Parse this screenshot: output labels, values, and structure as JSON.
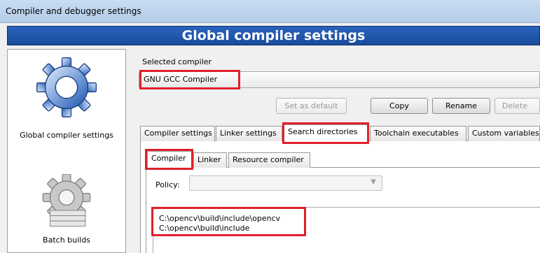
{
  "window": {
    "title": "Compiler and debugger settings"
  },
  "header": {
    "title": "Global compiler settings"
  },
  "sidebar": {
    "items": [
      {
        "label": "Global compiler settings",
        "icon": "gear-icon"
      },
      {
        "label": "Batch builds",
        "icon": "gear-stack-icon"
      }
    ]
  },
  "compiler": {
    "section_label": "Selected compiler",
    "selected": "GNU GCC Compiler",
    "buttons": {
      "set_default": "Set as default",
      "copy": "Copy",
      "rename": "Rename",
      "delete": "Delete"
    }
  },
  "tabs": [
    "Compiler settings",
    "Linker settings",
    "Search directories",
    "Toolchain executables",
    "Custom variables"
  ],
  "active_tab": "Search directories",
  "subtabs": [
    "Compiler",
    "Linker",
    "Resource compiler"
  ],
  "active_subtab": "Compiler",
  "policy": {
    "label": "Policy:",
    "value": ""
  },
  "directories": [
    "C:\\opencv\\build\\include\\opencv",
    "C:\\opencv\\build\\include"
  ],
  "colors": {
    "header_blue": "#1f56ad",
    "highlight_red": "#e0202a"
  }
}
